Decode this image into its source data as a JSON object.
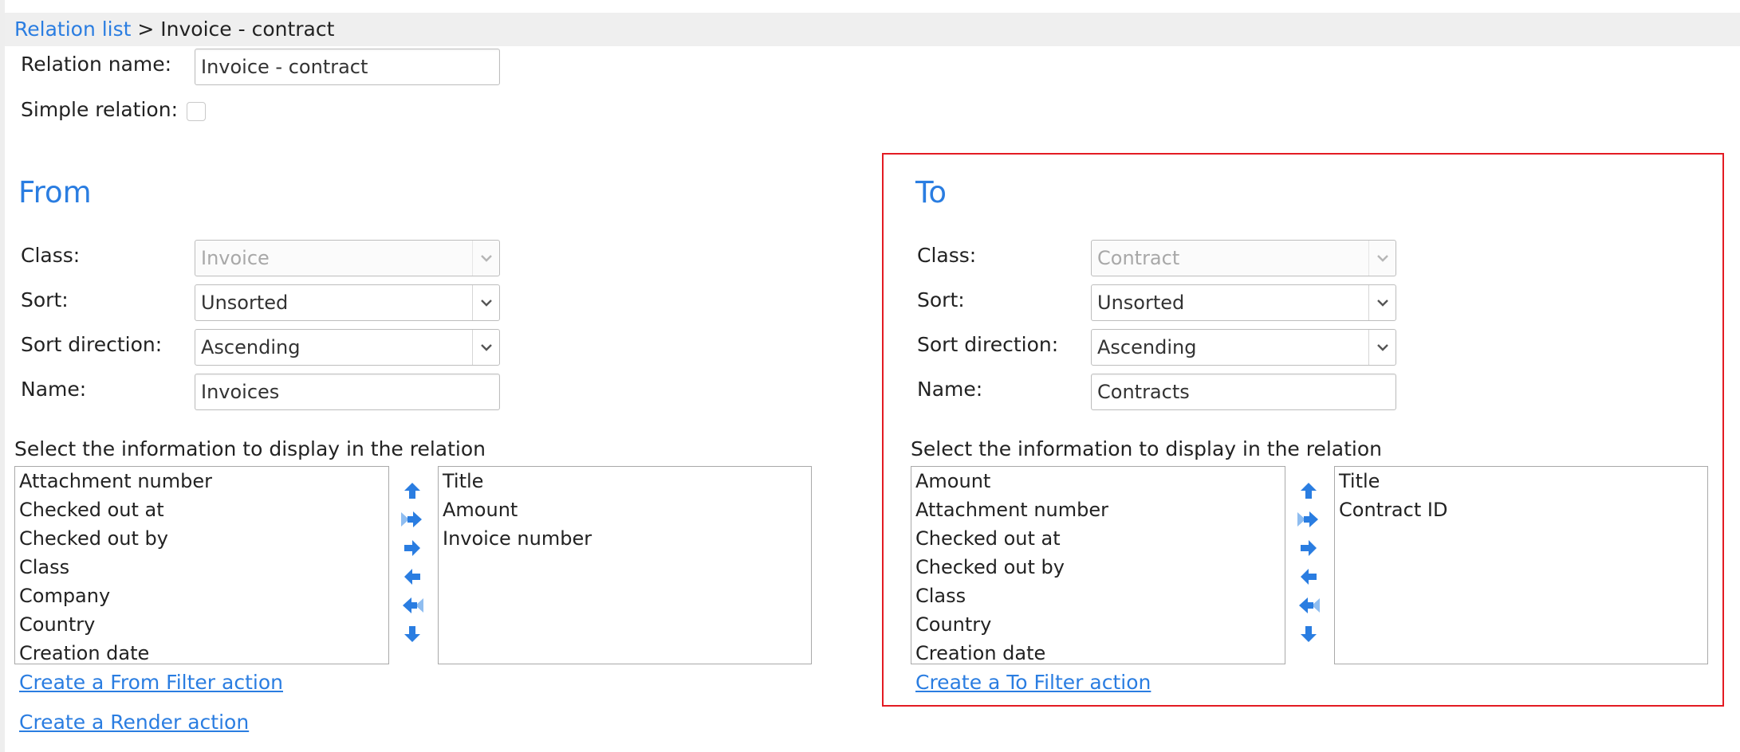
{
  "breadcrumb": {
    "link": "Relation list",
    "separator": " > ",
    "current": "Invoice - contract"
  },
  "relation": {
    "name_label": "Relation name:",
    "name_value": "Invoice - contract",
    "simple_label": "Simple relation:"
  },
  "from": {
    "heading": "From",
    "class_label": "Class:",
    "class_value": "Invoice",
    "sort_label": "Sort:",
    "sort_value": "Unsorted",
    "dir_label": "Sort direction:",
    "dir_value": "Ascending",
    "name_label": "Name:",
    "name_value": "Invoices",
    "select_label": "Select the information to display in the relation",
    "available": [
      "Attachment number",
      "Checked out at",
      "Checked out by",
      "Class",
      "Company",
      "Country",
      "Creation date"
    ],
    "selected": [
      "Title",
      "Amount",
      "Invoice number"
    ],
    "filter_link": "Create a From Filter action"
  },
  "to": {
    "heading": "To",
    "class_label": "Class:",
    "class_value": "Contract",
    "sort_label": "Sort:",
    "sort_value": "Unsorted",
    "dir_label": "Sort direction:",
    "dir_value": "Ascending",
    "name_label": "Name:",
    "name_value": "Contracts",
    "select_label": "Select the information to display in the relation",
    "available": [
      "Amount",
      "Attachment number",
      "Checked out at",
      "Checked out by",
      "Class",
      "Country",
      "Creation date"
    ],
    "selected": [
      "Title",
      "Contract ID"
    ],
    "filter_link": "Create a To Filter action"
  },
  "render_link": "Create a Render action",
  "icons": {
    "move_up": "arrow-up-icon",
    "add_all": "double-arrow-right-icon",
    "add": "arrow-right-icon",
    "remove": "arrow-left-icon",
    "remove_all": "double-arrow-left-icon",
    "move_down": "arrow-down-icon",
    "dropdown": "chevron-down-icon"
  },
  "colors": {
    "accent": "#2a7de1",
    "highlight_border": "#e31b23"
  }
}
